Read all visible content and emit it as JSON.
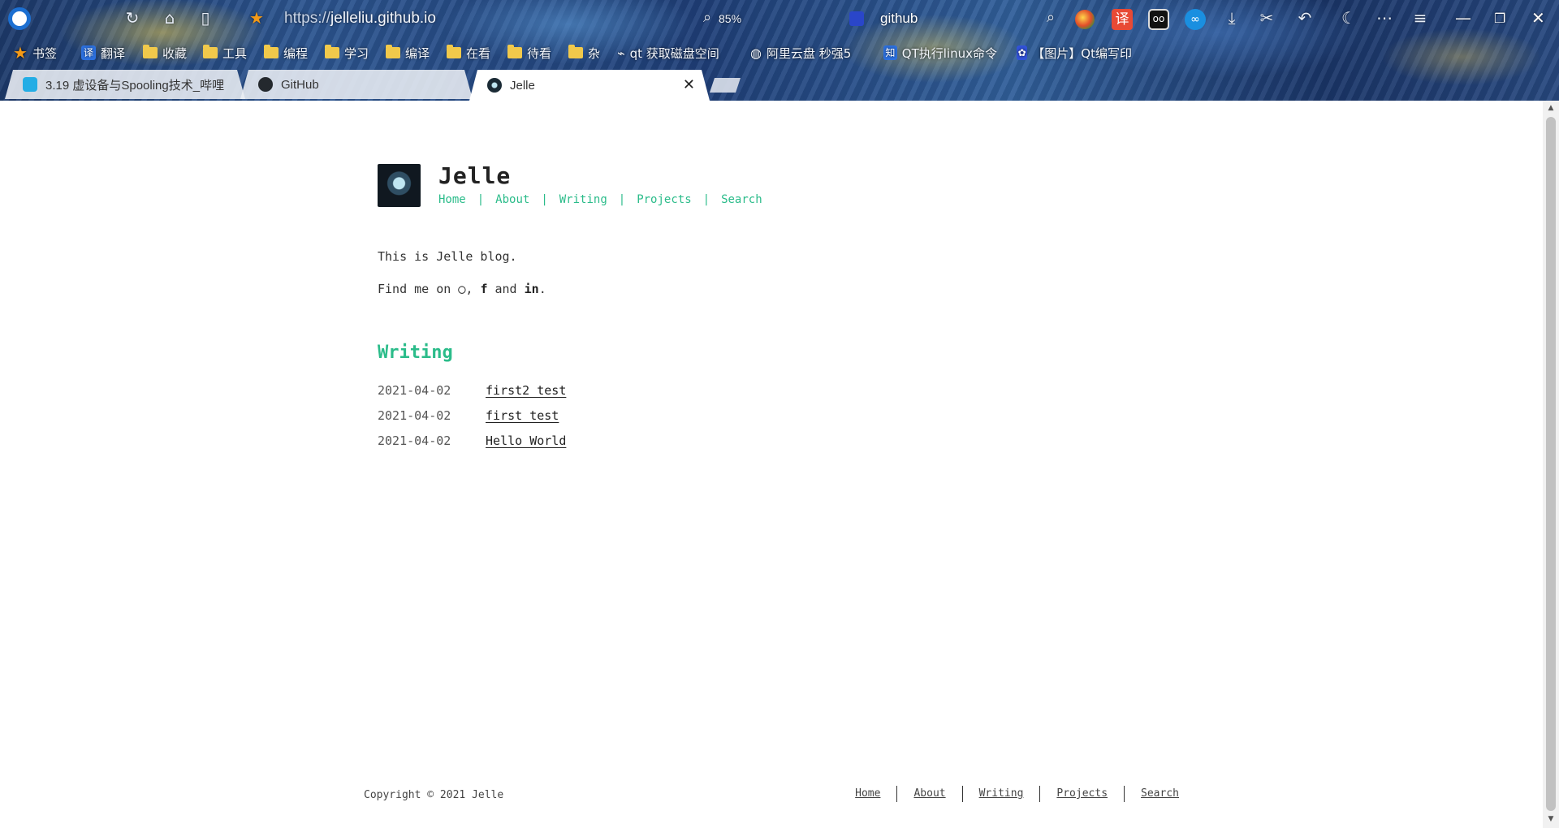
{
  "browser": {
    "url_scheme": "https://",
    "url_host": "jelleliu.github.io",
    "zoom": "85%",
    "search_query": "github",
    "extensions": {
      "translate_label": "译"
    },
    "bookmarks": [
      {
        "label": "书签",
        "icon": "star-icon"
      },
      {
        "label": "翻译",
        "icon": "translate-icon"
      },
      {
        "label": "收藏",
        "icon": "folder-icon"
      },
      {
        "label": "工具",
        "icon": "folder-icon"
      },
      {
        "label": "编程",
        "icon": "folder-icon"
      },
      {
        "label": "学习",
        "icon": "folder-icon"
      },
      {
        "label": "编译",
        "icon": "folder-icon"
      },
      {
        "label": "在看",
        "icon": "folder-icon"
      },
      {
        "label": "待看",
        "icon": "folder-icon"
      },
      {
        "label": "杂",
        "icon": "folder-icon"
      },
      {
        "label": "qt 获取磁盘空间",
        "icon": "link-icon"
      },
      {
        "label": "阿里云盘 秒强5",
        "icon": "globe-icon"
      },
      {
        "label": "QT执行linux命令",
        "icon": "zhihu-icon"
      },
      {
        "label": "【图片】Qt编写印",
        "icon": "baidu-icon"
      }
    ],
    "tabs": [
      {
        "label": "3.19 虚设备与Spooling技术_哔哩",
        "icon": "bilibili-icon",
        "active": false
      },
      {
        "label": "GitHub",
        "icon": "github-icon",
        "active": false
      },
      {
        "label": "Jelle",
        "icon": "avatar-icon",
        "active": true
      }
    ],
    "close_glyph": "✕"
  },
  "site": {
    "title": "Jelle",
    "nav": [
      "Home",
      "About",
      "Writing",
      "Projects",
      "Search"
    ],
    "intro_line": "This is Jelle blog.",
    "find_me_prefix": "Find me on",
    "find_me_and": "and",
    "social_icons": [
      "github-icon",
      "facebook-icon",
      "linkedin-icon"
    ],
    "social_glyphs": {
      "github": "◯",
      "facebook": "f",
      "linkedin": "in"
    },
    "writing_heading": "Writing",
    "posts": [
      {
        "date": "2021-04-02",
        "title": "first2 test"
      },
      {
        "date": "2021-04-02",
        "title": "first test"
      },
      {
        "date": "2021-04-02",
        "title": "Hello World"
      }
    ],
    "footer": {
      "copyright": "Copyright © 2021 Jelle",
      "nav": [
        "Home",
        "About",
        "Writing",
        "Projects",
        "Search"
      ]
    },
    "accent_color": "#2bbc8a"
  }
}
